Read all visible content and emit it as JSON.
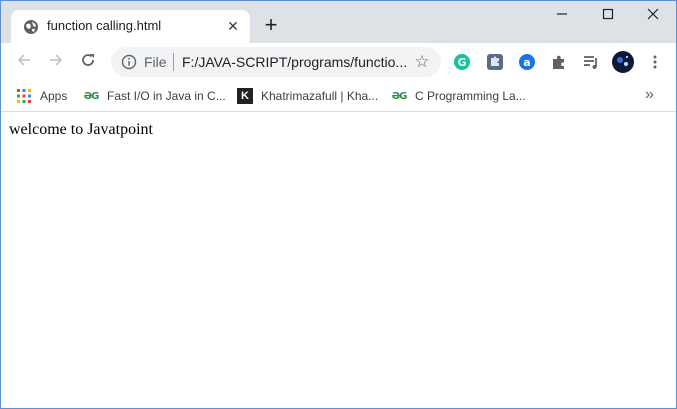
{
  "tab": {
    "title": "function calling.html",
    "favicon": "globe-icon",
    "close_glyph": "✕"
  },
  "new_tab_glyph": "+",
  "window_controls": {
    "minimize": "minimize-icon",
    "maximize": "maximize-icon",
    "close": "close-icon"
  },
  "toolbar": {
    "back": "back-arrow-icon",
    "forward": "forward-arrow-icon",
    "reload": "reload-icon"
  },
  "omnibox": {
    "chip_label": "File",
    "url": "F:/JAVA-SCRIPT/programs/functio...",
    "star": "☆"
  },
  "extensions": [
    {
      "name": "grammarly-icon",
      "color": "#15c39a"
    },
    {
      "name": "puzzle-extension-icon",
      "color": "#5a6b8c"
    },
    {
      "name": "a-extension-icon",
      "color": "#1a73e8"
    },
    {
      "name": "extensions-puzzle-icon",
      "color": "#5f6368"
    },
    {
      "name": "reading-list-icon",
      "color": "#5f6368"
    },
    {
      "name": "profile-avatar",
      "color": "#0b1a3a"
    }
  ],
  "bookmarks": {
    "apps_label": "Apps",
    "items": [
      {
        "label": "Fast I/O in Java in C...",
        "icon": "geeksforgeeks-icon",
        "glyph": "ƏG"
      },
      {
        "label": "Khatrimazafull | Kha...",
        "icon": "k-icon",
        "glyph": "K"
      },
      {
        "label": "C Programming La...",
        "icon": "geeksforgeeks-icon",
        "glyph": "ƏG"
      }
    ],
    "more_glyph": "»"
  },
  "page": {
    "text": "welcome to Javatpoint"
  },
  "colors": {
    "tabstrip_bg": "#dee1e6",
    "omnibox_bg": "#f1f3f4",
    "window_border": "#5b8fd6"
  }
}
